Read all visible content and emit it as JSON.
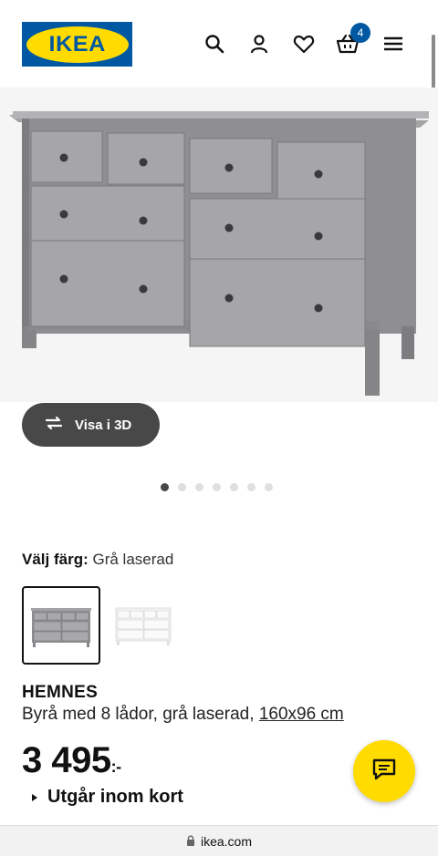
{
  "header": {
    "logo_text": "IKEA",
    "icons": [
      "search-icon",
      "account-icon",
      "heart-icon",
      "basket-icon",
      "menu-icon"
    ],
    "cart_count": "4"
  },
  "gallery": {
    "view_3d_label": "Visa i 3D",
    "image_count": 7,
    "active_index": 0
  },
  "color": {
    "label": "Välj färg:",
    "value": "Grå laserad",
    "options": [
      "Grå laserad",
      "Vit"
    ]
  },
  "product": {
    "name": "HEMNES",
    "description": "Byrå med 8 lådor, grå laserad,",
    "size": "160x96 cm",
    "price": "3 495",
    "price_suffix": ":-",
    "availability": "Utgår inom kort"
  },
  "browser": {
    "url": "ikea.com"
  },
  "colors": {
    "ikea_blue": "#0058a3",
    "ikea_yellow": "#ffdb00",
    "dark_button": "#484848"
  }
}
